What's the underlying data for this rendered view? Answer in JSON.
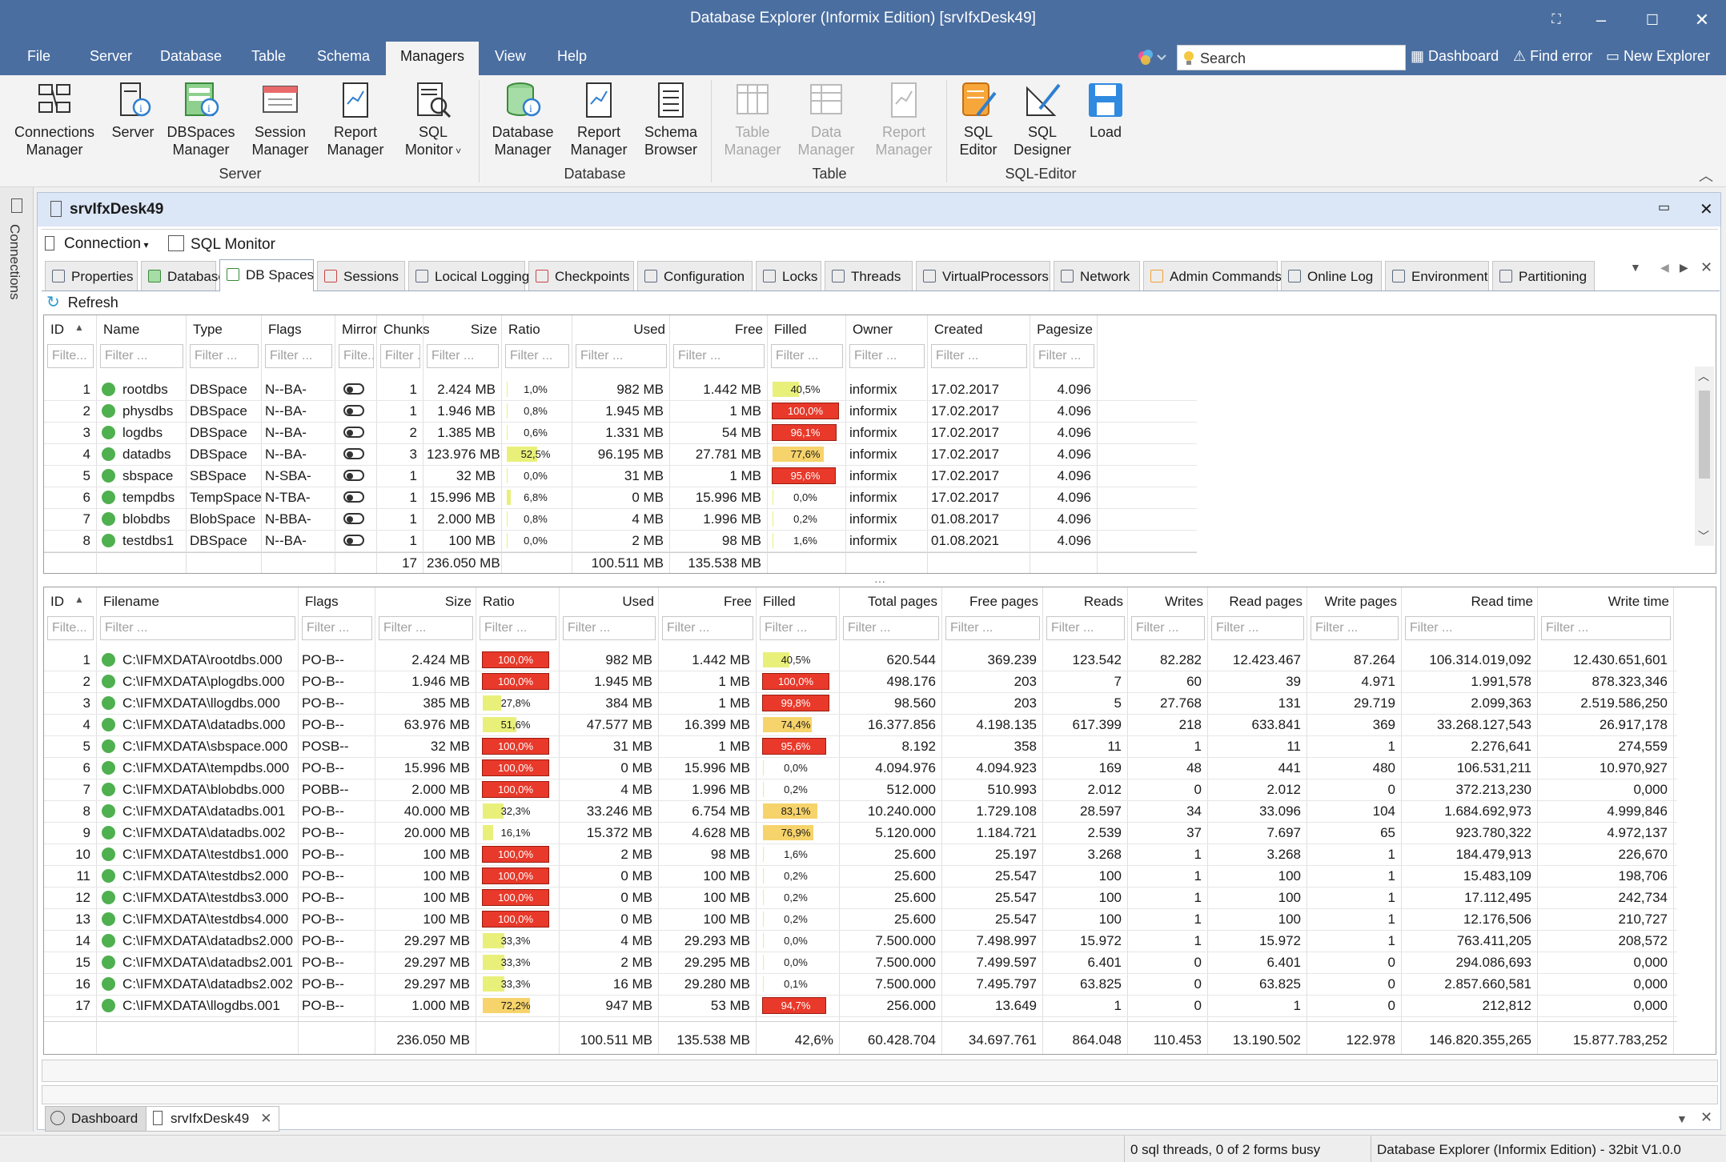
{
  "window": {
    "title": "Database Explorer (Informix Edition) [srvIfxDesk49]"
  },
  "menu": {
    "items": [
      "File",
      "Server",
      "Database",
      "Table",
      "Schema",
      "Managers",
      "View",
      "Help"
    ],
    "active": "Managers"
  },
  "quick": {
    "search_placeholder": "Search",
    "dashboard": "Dashboard",
    "find_error": "Find error",
    "new_explorer": "New Explorer"
  },
  "ribbon": {
    "server_group": "Server",
    "database_group": "Database",
    "table_group": "Table",
    "sqleditor_group": "SQL-Editor",
    "buttons": {
      "connections_manager": [
        "Connections",
        "Manager"
      ],
      "server": [
        "Server"
      ],
      "dbspaces_manager": [
        "DBSpaces",
        "Manager"
      ],
      "session_manager": [
        "Session",
        "Manager"
      ],
      "report_manager_1": [
        "Report",
        "Manager"
      ],
      "sql_monitor": [
        "SQL",
        "Monitor"
      ],
      "database_manager": [
        "Database",
        "Manager"
      ],
      "report_manager_2": [
        "Report",
        "Manager"
      ],
      "schema_browser": [
        "Schema",
        "Browser"
      ],
      "table_manager": [
        "Table",
        "Manager"
      ],
      "data_manager": [
        "Data",
        "Manager"
      ],
      "report_manager_3": [
        "Report",
        "Manager"
      ],
      "sql_editor": [
        "SQL",
        "Editor"
      ],
      "sql_designer": [
        "SQL",
        "Designer"
      ],
      "load": [
        "Load"
      ]
    }
  },
  "side": {
    "connections_label": "Connections"
  },
  "doc": {
    "title": "srvIfxDesk49",
    "connection": "Connection",
    "sql_monitor": "SQL Monitor",
    "refresh": "Refresh",
    "tabs": [
      "Properties",
      "Databases",
      "DB Spaces",
      "Sessions",
      "Locical Logging",
      "Checkpoints",
      "Configuration",
      "Locks",
      "Threads",
      "VirtualProcessors",
      "Network",
      "Admin Commands",
      "Online Log",
      "Environment",
      "Partitioning"
    ],
    "active_tab": "DB Spaces"
  },
  "top_grid": {
    "filter_placeholder": "Filter ...",
    "filter_short": "Filte...",
    "columns": [
      "ID",
      "Name",
      "Type",
      "Flags",
      "Mirror",
      "Chunks",
      "Size",
      "Ratio",
      "Used",
      "Free",
      "Filled",
      "Owner",
      "Created",
      "Pagesize"
    ],
    "rows": [
      {
        "id": "1",
        "name": "rootdbs",
        "type": "DBSpace",
        "flags": "N--BA-",
        "chunks": "1",
        "size": "2.424 MB",
        "ratio": "1,0%",
        "ratio_v": 1.0,
        "used": "982 MB",
        "free": "1.442 MB",
        "filled": "40,5%",
        "filled_v": 40.5,
        "owner": "informix",
        "created": "17.02.2017",
        "pagesize": "4.096"
      },
      {
        "id": "2",
        "name": "physdbs",
        "type": "DBSpace",
        "flags": "N--BA-",
        "chunks": "1",
        "size": "1.946 MB",
        "ratio": "0,8%",
        "ratio_v": 0.8,
        "used": "1.945 MB",
        "free": "1 MB",
        "filled": "100,0%",
        "filled_v": 100.0,
        "owner": "informix",
        "created": "17.02.2017",
        "pagesize": "4.096"
      },
      {
        "id": "3",
        "name": "logdbs",
        "type": "DBSpace",
        "flags": "N--BA-",
        "chunks": "2",
        "size": "1.385 MB",
        "ratio": "0,6%",
        "ratio_v": 0.6,
        "used": "1.331 MB",
        "free": "54 MB",
        "filled": "96,1%",
        "filled_v": 96.1,
        "owner": "informix",
        "created": "17.02.2017",
        "pagesize": "4.096"
      },
      {
        "id": "4",
        "name": "datadbs",
        "type": "DBSpace",
        "flags": "N--BA-",
        "chunks": "3",
        "size": "123.976 MB",
        "ratio": "52,5%",
        "ratio_v": 52.5,
        "used": "96.195 MB",
        "free": "27.781 MB",
        "filled": "77,6%",
        "filled_v": 77.6,
        "owner": "informix",
        "created": "17.02.2017",
        "pagesize": "4.096"
      },
      {
        "id": "5",
        "name": "sbspace",
        "type": "SBSpace",
        "flags": "N-SBA-",
        "chunks": "1",
        "size": "32 MB",
        "ratio": "0,0%",
        "ratio_v": 0.0,
        "used": "31 MB",
        "free": "1 MB",
        "filled": "95,6%",
        "filled_v": 95.6,
        "owner": "informix",
        "created": "17.02.2017",
        "pagesize": "4.096"
      },
      {
        "id": "6",
        "name": "tempdbs",
        "type": "TempSpace",
        "flags": "N-TBA-",
        "chunks": "1",
        "size": "15.996 MB",
        "ratio": "6,8%",
        "ratio_v": 6.8,
        "used": "0 MB",
        "free": "15.996 MB",
        "filled": "0,0%",
        "filled_v": 0.0,
        "owner": "informix",
        "created": "17.02.2017",
        "pagesize": "4.096"
      },
      {
        "id": "7",
        "name": "blobdbs",
        "type": "BlobSpace",
        "flags": "N-BBA-",
        "chunks": "1",
        "size": "2.000 MB",
        "ratio": "0,8%",
        "ratio_v": 0.8,
        "used": "4 MB",
        "free": "1.996 MB",
        "filled": "0,2%",
        "filled_v": 0.2,
        "owner": "informix",
        "created": "01.08.2017",
        "pagesize": "4.096"
      },
      {
        "id": "8",
        "name": "testdbs1",
        "type": "DBSpace",
        "flags": "N--BA-",
        "chunks": "1",
        "size": "100 MB",
        "ratio": "0,0%",
        "ratio_v": 0.0,
        "used": "2 MB",
        "free": "98 MB",
        "filled": "1,6%",
        "filled_v": 1.6,
        "owner": "informix",
        "created": "01.08.2021",
        "pagesize": "4.096"
      }
    ],
    "totals": {
      "chunks": "17",
      "size": "236.050 MB",
      "used": "100.511 MB",
      "free": "135.538 MB"
    }
  },
  "bottom_grid": {
    "columns": [
      "ID",
      "Filename",
      "Flags",
      "Size",
      "Ratio",
      "Used",
      "Free",
      "Filled",
      "Total pages",
      "Free pages",
      "Reads",
      "Writes",
      "Read pages",
      "Write pages",
      "Read time",
      "Write time"
    ],
    "rows": [
      {
        "id": "1",
        "file": "C:\\IFMXDATA\\rootdbs.000",
        "flags": "PO-B--",
        "size": "2.424 MB",
        "ratio": "100,0%",
        "ratio_v": 100.0,
        "used": "982 MB",
        "free": "1.442 MB",
        "filled": "40,5%",
        "filled_v": 40.5,
        "tp": "620.544",
        "fp": "369.239",
        "reads": "123.542",
        "writes": "82.282",
        "rp": "12.423.467",
        "wp": "87.264",
        "rt": "106.314.019,092",
        "wt": "12.430.651,601"
      },
      {
        "id": "2",
        "file": "C:\\IFMXDATA\\plogdbs.000",
        "flags": "PO-B--",
        "size": "1.946 MB",
        "ratio": "100,0%",
        "ratio_v": 100.0,
        "used": "1.945 MB",
        "free": "1 MB",
        "filled": "100,0%",
        "filled_v": 100.0,
        "tp": "498.176",
        "fp": "203",
        "reads": "7",
        "writes": "60",
        "rp": "39",
        "wp": "4.971",
        "rt": "1.991,578",
        "wt": "878.323,346"
      },
      {
        "id": "3",
        "file": "C:\\IFMXDATA\\llogdbs.000",
        "flags": "PO-B--",
        "size": "385 MB",
        "ratio": "27,8%",
        "ratio_v": 27.8,
        "used": "384 MB",
        "free": "1 MB",
        "filled": "99,8%",
        "filled_v": 99.8,
        "tp": "98.560",
        "fp": "203",
        "reads": "5",
        "writes": "27.768",
        "rp": "131",
        "wp": "29.719",
        "rt": "2.099,363",
        "wt": "2.519.586,250"
      },
      {
        "id": "4",
        "file": "C:\\IFMXDATA\\datadbs.000",
        "flags": "PO-B--",
        "size": "63.976 MB",
        "ratio": "51,6%",
        "ratio_v": 51.6,
        "used": "47.577 MB",
        "free": "16.399 MB",
        "filled": "74,4%",
        "filled_v": 74.4,
        "tp": "16.377.856",
        "fp": "4.198.135",
        "reads": "617.399",
        "writes": "218",
        "rp": "633.841",
        "wp": "369",
        "rt": "33.268.127,543",
        "wt": "26.917,178"
      },
      {
        "id": "5",
        "file": "C:\\IFMXDATA\\sbspace.000",
        "flags": "POSB--",
        "size": "32 MB",
        "ratio": "100,0%",
        "ratio_v": 100.0,
        "used": "31 MB",
        "free": "1 MB",
        "filled": "95,6%",
        "filled_v": 95.6,
        "tp": "8.192",
        "fp": "358",
        "reads": "11",
        "writes": "1",
        "rp": "11",
        "wp": "1",
        "rt": "2.276,641",
        "wt": "274,559"
      },
      {
        "id": "6",
        "file": "C:\\IFMXDATA\\tempdbs.000",
        "flags": "PO-B--",
        "size": "15.996 MB",
        "ratio": "100,0%",
        "ratio_v": 100.0,
        "used": "0 MB",
        "free": "15.996 MB",
        "filled": "0,0%",
        "filled_v": 0.0,
        "tp": "4.094.976",
        "fp": "4.094.923",
        "reads": "169",
        "writes": "48",
        "rp": "441",
        "wp": "480",
        "rt": "106.531,211",
        "wt": "10.970,927"
      },
      {
        "id": "7",
        "file": "C:\\IFMXDATA\\blobdbs.000",
        "flags": "POBB--",
        "size": "2.000 MB",
        "ratio": "100,0%",
        "ratio_v": 100.0,
        "used": "4 MB",
        "free": "1.996 MB",
        "filled": "0,2%",
        "filled_v": 0.2,
        "tp": "512.000",
        "fp": "510.993",
        "reads": "2.012",
        "writes": "0",
        "rp": "2.012",
        "wp": "0",
        "rt": "372.213,230",
        "wt": "0,000"
      },
      {
        "id": "8",
        "file": "C:\\IFMXDATA\\datadbs.001",
        "flags": "PO-B--",
        "size": "40.000 MB",
        "ratio": "32,3%",
        "ratio_v": 32.3,
        "used": "33.246 MB",
        "free": "6.754 MB",
        "filled": "83,1%",
        "filled_v": 83.1,
        "tp": "10.240.000",
        "fp": "1.729.108",
        "reads": "28.597",
        "writes": "34",
        "rp": "33.096",
        "wp": "104",
        "rt": "1.684.692,973",
        "wt": "4.999,846"
      },
      {
        "id": "9",
        "file": "C:\\IFMXDATA\\datadbs.002",
        "flags": "PO-B--",
        "size": "20.000 MB",
        "ratio": "16,1%",
        "ratio_v": 16.1,
        "used": "15.372 MB",
        "free": "4.628 MB",
        "filled": "76,9%",
        "filled_v": 76.9,
        "tp": "5.120.000",
        "fp": "1.184.721",
        "reads": "2.539",
        "writes": "37",
        "rp": "7.697",
        "wp": "65",
        "rt": "923.780,322",
        "wt": "4.972,137"
      },
      {
        "id": "10",
        "file": "C:\\IFMXDATA\\testdbs1.000",
        "flags": "PO-B--",
        "size": "100 MB",
        "ratio": "100,0%",
        "ratio_v": 100.0,
        "used": "2 MB",
        "free": "98 MB",
        "filled": "1,6%",
        "filled_v": 1.6,
        "tp": "25.600",
        "fp": "25.197",
        "reads": "3.268",
        "writes": "1",
        "rp": "3.268",
        "wp": "1",
        "rt": "184.479,913",
        "wt": "226,670"
      },
      {
        "id": "11",
        "file": "C:\\IFMXDATA\\testdbs2.000",
        "flags": "PO-B--",
        "size": "100 MB",
        "ratio": "100,0%",
        "ratio_v": 100.0,
        "used": "0 MB",
        "free": "100 MB",
        "filled": "0,2%",
        "filled_v": 0.2,
        "tp": "25.600",
        "fp": "25.547",
        "reads": "100",
        "writes": "1",
        "rp": "100",
        "wp": "1",
        "rt": "15.483,109",
        "wt": "198,706"
      },
      {
        "id": "12",
        "file": "C:\\IFMXDATA\\testdbs3.000",
        "flags": "PO-B--",
        "size": "100 MB",
        "ratio": "100,0%",
        "ratio_v": 100.0,
        "used": "0 MB",
        "free": "100 MB",
        "filled": "0,2%",
        "filled_v": 0.2,
        "tp": "25.600",
        "fp": "25.547",
        "reads": "100",
        "writes": "1",
        "rp": "100",
        "wp": "1",
        "rt": "17.112,495",
        "wt": "242,734"
      },
      {
        "id": "13",
        "file": "C:\\IFMXDATA\\testdbs4.000",
        "flags": "PO-B--",
        "size": "100 MB",
        "ratio": "100,0%",
        "ratio_v": 100.0,
        "used": "0 MB",
        "free": "100 MB",
        "filled": "0,2%",
        "filled_v": 0.2,
        "tp": "25.600",
        "fp": "25.547",
        "reads": "100",
        "writes": "1",
        "rp": "100",
        "wp": "1",
        "rt": "12.176,506",
        "wt": "210,727"
      },
      {
        "id": "14",
        "file": "C:\\IFMXDATA\\datadbs2.000",
        "flags": "PO-B--",
        "size": "29.297 MB",
        "ratio": "33,3%",
        "ratio_v": 33.3,
        "used": "4 MB",
        "free": "29.293 MB",
        "filled": "0,0%",
        "filled_v": 0.0,
        "tp": "7.500.000",
        "fp": "7.498.997",
        "reads": "15.972",
        "writes": "1",
        "rp": "15.972",
        "wp": "1",
        "rt": "763.411,205",
        "wt": "208,572"
      },
      {
        "id": "15",
        "file": "C:\\IFMXDATA\\datadbs2.001",
        "flags": "PO-B--",
        "size": "29.297 MB",
        "ratio": "33,3%",
        "ratio_v": 33.3,
        "used": "2 MB",
        "free": "29.295 MB",
        "filled": "0,0%",
        "filled_v": 0.0,
        "tp": "7.500.000",
        "fp": "7.499.597",
        "reads": "6.401",
        "writes": "0",
        "rp": "6.401",
        "wp": "0",
        "rt": "294.086,693",
        "wt": "0,000"
      },
      {
        "id": "16",
        "file": "C:\\IFMXDATA\\datadbs2.002",
        "flags": "PO-B--",
        "size": "29.297 MB",
        "ratio": "33,3%",
        "ratio_v": 33.3,
        "used": "16 MB",
        "free": "29.280 MB",
        "filled": "0,1%",
        "filled_v": 0.1,
        "tp": "7.500.000",
        "fp": "7.495.797",
        "reads": "63.825",
        "writes": "0",
        "rp": "63.825",
        "wp": "0",
        "rt": "2.857.660,581",
        "wt": "0,000"
      },
      {
        "id": "17",
        "file": "C:\\IFMXDATA\\llogdbs.001",
        "flags": "PO-B--",
        "size": "1.000 MB",
        "ratio": "72,2%",
        "ratio_v": 72.2,
        "used": "947 MB",
        "free": "53 MB",
        "filled": "94,7%",
        "filled_v": 94.7,
        "tp": "256.000",
        "fp": "13.649",
        "reads": "1",
        "writes": "0",
        "rp": "1",
        "wp": "0",
        "rt": "212,812",
        "wt": "0,000"
      }
    ],
    "totals": {
      "size": "236.050 MB",
      "used": "100.511 MB",
      "free": "135.538 MB",
      "filled": "42,6%",
      "tp": "60.428.704",
      "fp": "34.697.761",
      "reads": "864.048",
      "writes": "110.453",
      "rp": "13.190.502",
      "wp": "122.978",
      "rt": "146.820.355,265",
      "wt": "15.877.783,252"
    }
  },
  "bottom_tabs": {
    "dashboard": "Dashboard",
    "server": "srvIfxDesk49"
  },
  "status": {
    "threads": "0 sql threads, 0 of 2 forms busy",
    "app": "Database Explorer (Informix Edition) - 32bit V1.0.0"
  },
  "colors": {
    "titlebar": "#4a6ea0",
    "high": "#e8392a",
    "mid": "#f6d36b",
    "low": "#e9f07a",
    "ok_dot": "#4eb04e"
  }
}
